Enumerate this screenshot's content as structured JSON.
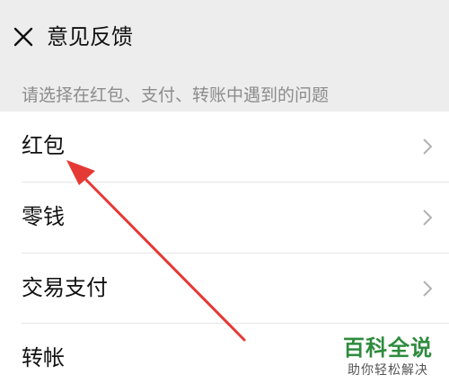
{
  "header": {
    "close_icon": "close-icon",
    "title": "意见反馈"
  },
  "hint": "请选择在红包、支付、转账中遇到的问题",
  "items": [
    {
      "label": "红包",
      "icon": "chevron-right-icon"
    },
    {
      "label": "零钱",
      "icon": "chevron-right-icon"
    },
    {
      "label": "交易支付",
      "icon": "chevron-right-icon"
    },
    {
      "label": "转帐",
      "icon": "chevron-right-icon"
    }
  ],
  "annotation": {
    "color": "#e53935",
    "points_to": "红包"
  },
  "watermark": {
    "title": "百科全说",
    "subtitle": "助你轻松解决",
    "color": "#2e8b3d"
  }
}
